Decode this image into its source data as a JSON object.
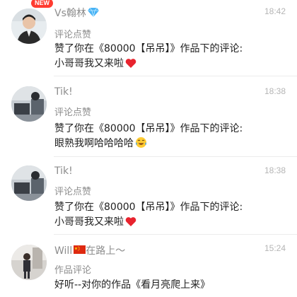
{
  "notifications": [
    {
      "avatar": "person-photo-avatar",
      "badge": "NEW",
      "name": "Vs翰林",
      "name_icon": "diamond-icon",
      "time": "18:42",
      "action": "评论点赞",
      "content_line1": "赞了你在《80000【吊吊】》作品下的评论:",
      "content_line2": "小哥哥我又来啦",
      "content_icon": "red-heart-icon"
    },
    {
      "avatar": "desk-photo-avatar",
      "name": "Tik!",
      "time": "18:38",
      "action": "评论点赞",
      "content_line1": "赞了你在《80000【吊吊】》作品下的评论:",
      "content_line2": "眼熟我啊哈哈哈哈",
      "content_icon": "tears-of-joy-icon"
    },
    {
      "avatar": "desk-photo-avatar",
      "name": "Tik!",
      "time": "18:38",
      "action": "评论点赞",
      "content_line1": "赞了你在《80000【吊吊】》作品下的评论:",
      "content_line2": "小哥哥我又来啦",
      "content_icon": "red-heart-icon"
    },
    {
      "avatar": "street-photo-avatar",
      "name_prefix": "Will",
      "name_icon": "china-flag-icon",
      "name_suffix": "在路上～",
      "time": "15:24",
      "action": "作品评论",
      "content_line1": "好听--对你的作品《看月亮爬上来》"
    }
  ]
}
